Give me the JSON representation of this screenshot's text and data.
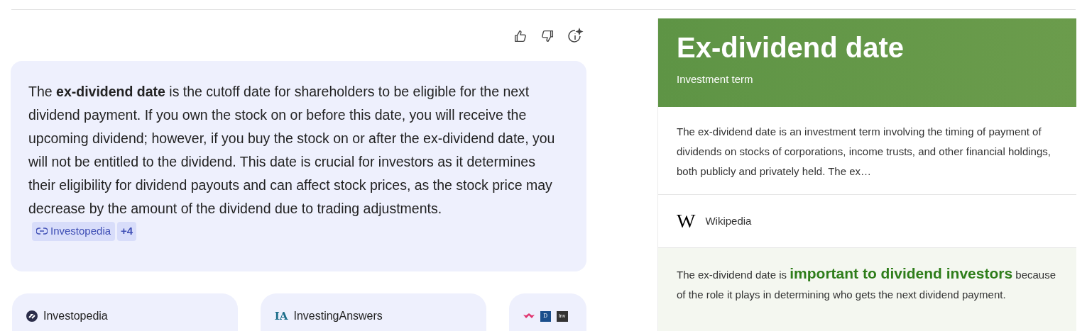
{
  "answer": {
    "text": "The **ex-dividend date** is the cutoff date for shareholders to be eligible for the next dividend payment. If you own the stock on or before this date, you will receive the upcoming dividend; however, if you buy the stock on or after the ex-dividend date, you will not be entitled to the dividend. This date is crucial for investors as it determines their eligibility for dividend payouts and can affect stock prices, as the stock price may decrease by the amount of the dividend due to trading adjustments.",
    "citation": "Investopedia",
    "more": "+4"
  },
  "sources": [
    {
      "kind": "investopedia",
      "name": "Investopedia"
    },
    {
      "kind": "ia",
      "logo": "IA",
      "name": "InvestingAnswers"
    },
    {
      "kind": "multi",
      "logos": [
        "D",
        "Inv"
      ]
    }
  ],
  "panel": {
    "title": "Ex-dividend date",
    "subtitle": "Investment term",
    "description": "The ex-dividend date is an investment term involving the timing of payment of dividends on stocks of corporations, income trusts, and other financial holdings, both publicly and privately held. The ex…",
    "source_logo": "W",
    "source": "Wikipedia",
    "highlight": "The ex-dividend date is **important to dividend investors** because of the role it plays in determining who gets the next dividend payment."
  }
}
